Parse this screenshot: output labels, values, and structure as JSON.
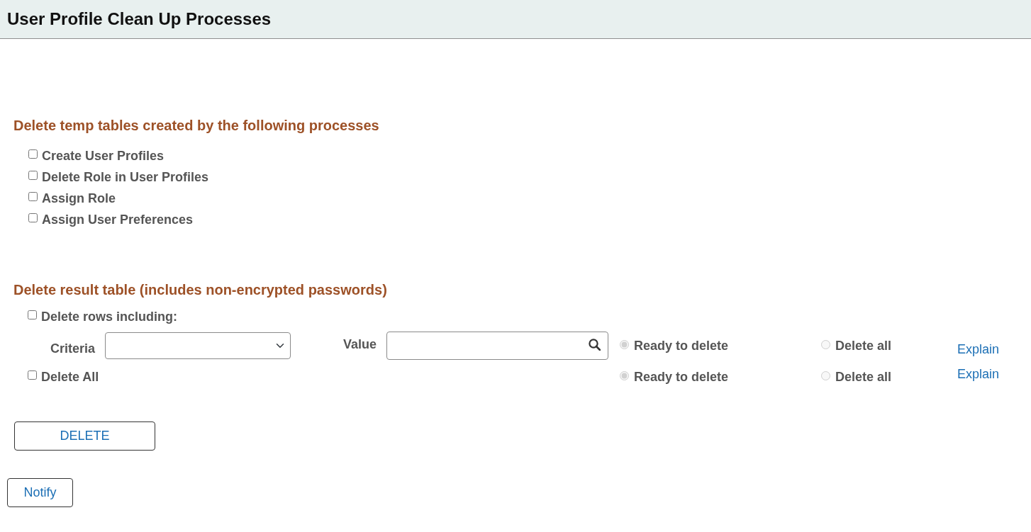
{
  "header": {
    "title": "User Profile Clean Up Processes"
  },
  "temp_tables": {
    "heading": "Delete temp tables created by the following processes",
    "processes": [
      {
        "label": "Create User Profiles",
        "checked": false
      },
      {
        "label": "Delete Role in User Profiles",
        "checked": false
      },
      {
        "label": "Assign Role",
        "checked": false
      },
      {
        "label": "Assign User Preferences",
        "checked": false
      }
    ]
  },
  "result_table": {
    "heading": "Delete result table (includes non-encrypted passwords)",
    "rows": [
      {
        "kind": "filtered",
        "label": "Delete rows including:",
        "checked": false,
        "criteria_label": "Criteria",
        "value_label": "Value",
        "options": [
          {
            "label": "Ready to delete",
            "selected": true,
            "disabled": true
          },
          {
            "label": "Delete all",
            "selected": false,
            "disabled": true
          }
        ],
        "link": "Explain"
      },
      {
        "kind": "all",
        "label": "Delete All",
        "checked": false,
        "options": [
          {
            "label": "Ready to delete",
            "selected": true,
            "disabled": true
          },
          {
            "label": "Delete all",
            "selected": false,
            "disabled": true
          }
        ],
        "link": "Explain"
      }
    ]
  },
  "delete_button": "DELETE",
  "notify_button": "Notify"
}
